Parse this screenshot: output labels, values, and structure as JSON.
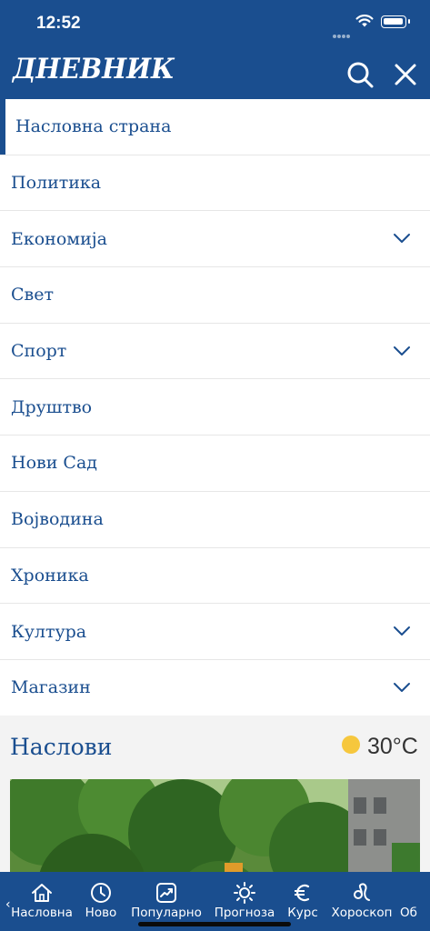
{
  "status_bar": {
    "time": "12:52"
  },
  "header": {
    "logo": "ДНЕВНИК"
  },
  "menu": {
    "items": [
      {
        "label": "Насловна страна",
        "expandable": false,
        "active": true
      },
      {
        "label": "Политика",
        "expandable": false
      },
      {
        "label": "Економија",
        "expandable": true
      },
      {
        "label": "Свет",
        "expandable": false
      },
      {
        "label": "Спорт",
        "expandable": true
      },
      {
        "label": "Друштво",
        "expandable": false
      },
      {
        "label": "Нови Сад",
        "expandable": false
      },
      {
        "label": "Војводина",
        "expandable": false
      },
      {
        "label": "Хроника",
        "expandable": false
      },
      {
        "label": "Култура",
        "expandable": true
      },
      {
        "label": "Магазин",
        "expandable": true
      }
    ]
  },
  "headlines": {
    "title": "Наслови",
    "weather": {
      "icon": "sun-icon",
      "temperature": "30°C"
    }
  },
  "tabbar": {
    "items": [
      {
        "label": "Насловна",
        "icon": "home-icon"
      },
      {
        "label": "Ново",
        "icon": "clock-icon"
      },
      {
        "label": "Популарно",
        "icon": "trending-icon"
      },
      {
        "label": "Прогноза",
        "icon": "sun-outline-icon"
      },
      {
        "label": "Курс",
        "icon": "euro-icon"
      },
      {
        "label": "Хороскоп",
        "icon": "leo-icon"
      },
      {
        "label": "Об",
        "icon": ""
      }
    ]
  },
  "colors": {
    "brand": "#1a4e8f",
    "sun": "#f6c73d"
  }
}
